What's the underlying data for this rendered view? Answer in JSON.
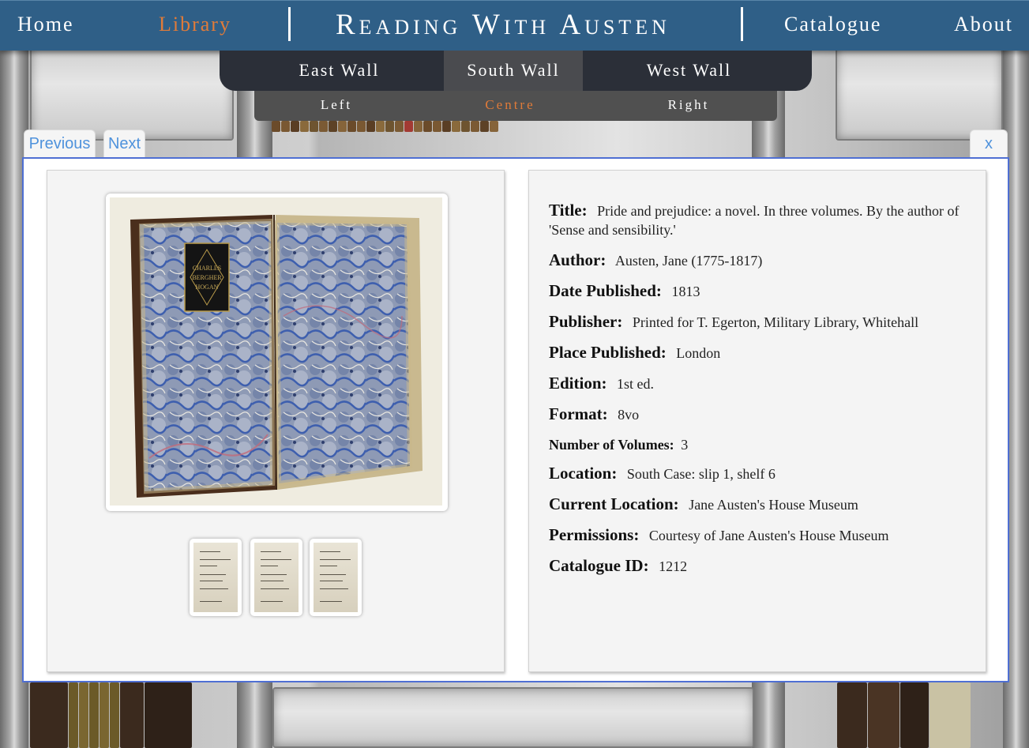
{
  "nav": {
    "home": "Home",
    "library": "Library",
    "brand": "Reading With Austen",
    "catalogue": "Catalogue",
    "about": "About"
  },
  "walls": [
    "East Wall",
    "South Wall",
    "West Wall"
  ],
  "active_wall": "South Wall",
  "sections": [
    "Left",
    "Centre",
    "Right"
  ],
  "active_section": "Centre",
  "modal": {
    "previous": "Previous",
    "next": "Next",
    "close": "x"
  },
  "bookplate": [
    "CHARLES",
    "BERGHER",
    "HOGAN"
  ],
  "record": {
    "title": {
      "label": "Title:",
      "value": "Pride and prejudice: a novel. In three volumes. By the author of 'Sense and sensibility.'"
    },
    "author": {
      "label": "Author:",
      "value": "Austen, Jane (1775-1817)"
    },
    "date": {
      "label": "Date Published:",
      "value": "1813"
    },
    "publisher": {
      "label": "Publisher:",
      "value": "Printed for T. Egerton, Military Library, Whitehall"
    },
    "place": {
      "label": "Place Published:",
      "value": "London"
    },
    "edition": {
      "label": "Edition:",
      "value": "1st ed."
    },
    "format": {
      "label": "Format:",
      "value": "8vo"
    },
    "volumes": {
      "label": "Number of Volumes:",
      "value": "3"
    },
    "location": {
      "label": "Location:",
      "value": "South Case: slip 1, shelf 6"
    },
    "current_location": {
      "label": "Current Location:",
      "value": "Jane Austen's House Museum"
    },
    "permissions": {
      "label": "Permissions:",
      "value": "Courtesy of Jane Austen's House Museum"
    },
    "catalogue_id": {
      "label": "Catalogue ID:",
      "value": "1212"
    }
  },
  "thumbnails": [
    "volume-1-title-page",
    "volume-2-title-page",
    "volume-3-title-page"
  ]
}
